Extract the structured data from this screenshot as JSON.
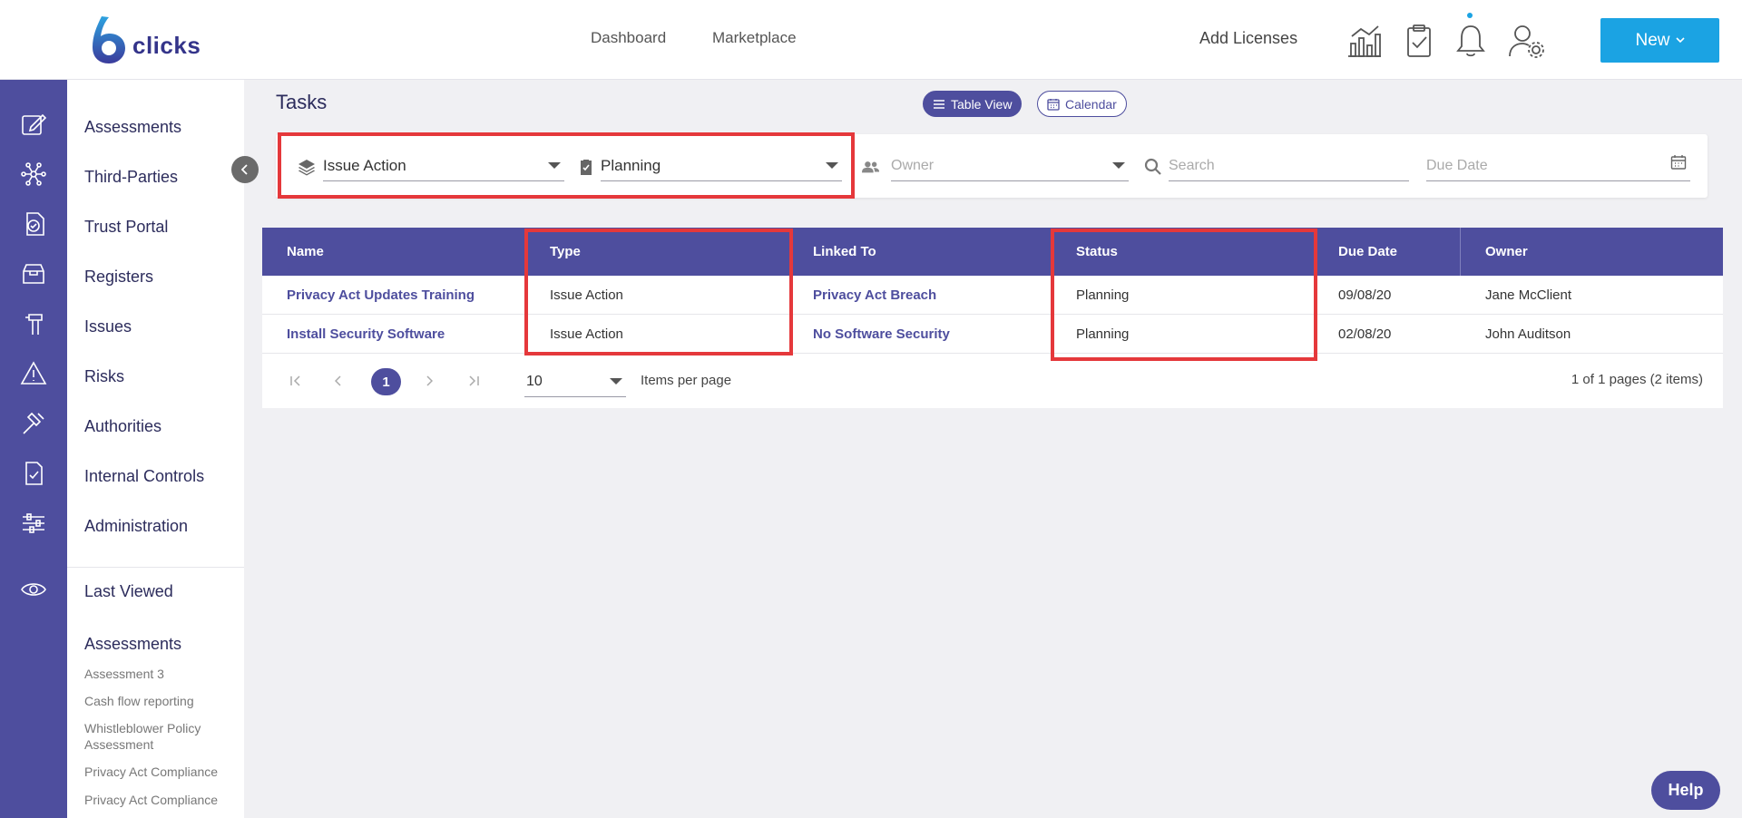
{
  "brand": {
    "name": "clicks",
    "accent": "#1ba3e3",
    "primary": "#4e4e9e",
    "highlight": "#e5383b"
  },
  "topnav": {
    "dashboard": "Dashboard",
    "marketplace": "Marketplace",
    "add_licenses": "Add Licenses",
    "new_label": "New"
  },
  "sidebar": {
    "items": [
      "Assessments",
      "Third-Parties",
      "Trust Portal",
      "Registers",
      "Issues",
      "Risks",
      "Authorities",
      "Internal Controls",
      "Administration"
    ],
    "last_viewed": "Last Viewed",
    "recent_section": "Assessments",
    "recent": [
      "Assessment 3",
      "Cash flow reporting",
      "Whistleblower Policy Assessment",
      "Privacy Act Compliance",
      "Privacy Act Compliance"
    ]
  },
  "page": {
    "title": "Tasks",
    "table_view": "Table View",
    "calendar_view": "Calendar"
  },
  "filters": {
    "type_value": "Issue Action",
    "status_value": "Planning",
    "owner_placeholder": "Owner",
    "search_placeholder": "Search",
    "due_placeholder": "Due Date"
  },
  "table": {
    "headers": {
      "name": "Name",
      "type": "Type",
      "linked": "Linked To",
      "status": "Status",
      "due": "Due Date",
      "owner": "Owner"
    },
    "rows": [
      {
        "name": "Privacy Act Updates Training",
        "type": "Issue Action",
        "linked": "Privacy Act Breach",
        "status": "Planning",
        "due": "09/08/20",
        "owner": "Jane McClient"
      },
      {
        "name": "Install Security Software",
        "type": "Issue Action",
        "linked": "No Software Security",
        "status": "Planning",
        "due": "02/08/20",
        "owner": "John Auditson"
      }
    ]
  },
  "pager": {
    "current": "1",
    "per_page": "10",
    "per_page_label": "Items per page",
    "info": "1 of 1 pages (2 items)"
  },
  "help": "Help"
}
